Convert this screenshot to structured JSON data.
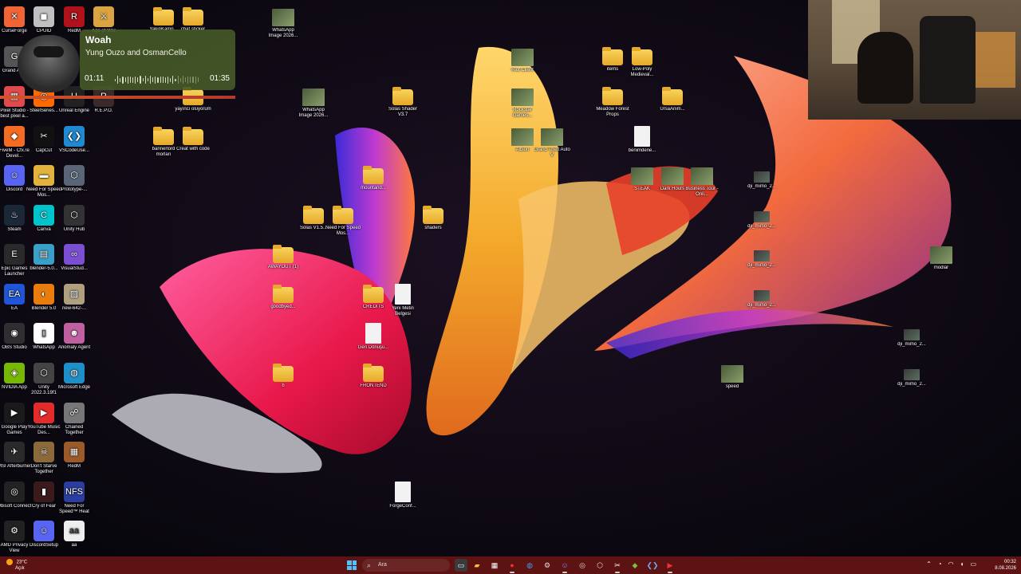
{
  "media_player": {
    "title": "Woah",
    "artist": "Yung Ouzo and OsmanCello",
    "elapsed": "01:11",
    "duration": "01:35",
    "progress": 0.72
  },
  "left_icons": [
    {
      "label": "CurseForge",
      "color": "#f16436",
      "glyph": "✕"
    },
    {
      "label": "CPUID",
      "color": "#c0c0c0",
      "glyph": "◼"
    },
    {
      "label": "RedM",
      "color": "#b0121b",
      "glyph": "R"
    },
    {
      "label": "Age of War",
      "color": "#d9a441",
      "glyph": "⚔"
    },
    {
      "label": "Grand Auto",
      "color": "#555555",
      "glyph": "G"
    },
    {
      "label": "Pixel Studio - best pixel a...",
      "color": "#e04a4a",
      "glyph": "▦"
    },
    {
      "label": "SteelSeries...",
      "color": "#ff6a00",
      "glyph": "◎"
    },
    {
      "label": "Unreal Engine",
      "color": "#222222",
      "glyph": "U"
    },
    {
      "label": "R.E.P.O.",
      "color": "#3a2a2a",
      "glyph": "R"
    },
    {
      "label": "FiveM - Cfx.re Devel...",
      "color": "#f46c22",
      "glyph": "◆"
    },
    {
      "label": "CapCut",
      "color": "#111111",
      "glyph": "✂"
    },
    {
      "label": "VSCodeUse...",
      "color": "#1f8ad2",
      "glyph": "❮❯"
    },
    {
      "label": "Discord",
      "color": "#5865f2",
      "glyph": "☺"
    },
    {
      "label": "Need For Speed Mos...",
      "color": "#e3b23c",
      "glyph": "▬"
    },
    {
      "label": "Prototype-...",
      "color": "#5a6678",
      "glyph": "⬡"
    },
    {
      "label": "Steam",
      "color": "#1b2838",
      "glyph": "♨"
    },
    {
      "label": "Canva",
      "color": "#00c4cc",
      "glyph": "C"
    },
    {
      "label": "Unity Hub",
      "color": "#333333",
      "glyph": "⬡"
    },
    {
      "label": "Epic Games Launcher",
      "color": "#2a2a2a",
      "glyph": "E"
    },
    {
      "label": "blender-5.0...",
      "color": "#3aa0c8",
      "glyph": "▤"
    },
    {
      "label": "VisualStud...",
      "color": "#7a4fd1",
      "glyph": "∞"
    },
    {
      "label": "EA",
      "color": "#1f55d8",
      "glyph": "EA"
    },
    {
      "label": "Blender 5.0",
      "color": "#e87d0d",
      "glyph": "◐"
    },
    {
      "label": "new-642-...",
      "color": "#b0a080",
      "glyph": "▨"
    },
    {
      "label": "OBS Studio",
      "color": "#302e31",
      "glyph": "◉"
    },
    {
      "label": "WhatsApp",
      "color": "#ffffff",
      "glyph": "▯"
    },
    {
      "label": "Anomaly Agent",
      "color": "#c060a0",
      "glyph": "☻"
    },
    {
      "label": "NVIDIA App",
      "color": "#76b900",
      "glyph": "◈"
    },
    {
      "label": "Unity 2022.3.19f1",
      "color": "#444444",
      "glyph": "⬡"
    },
    {
      "label": "Microsoft Edge",
      "color": "#1e90c8",
      "glyph": "◍"
    },
    {
      "label": "Google Play Games",
      "color": "#1a1a1a",
      "glyph": "▶"
    },
    {
      "label": "YouTube Music Des...",
      "color": "#e32b2b",
      "glyph": "▶"
    },
    {
      "label": "Chained Together",
      "color": "#777777",
      "glyph": "☍"
    },
    {
      "label": "MSI Afterburner",
      "color": "#2a2a2a",
      "glyph": "✈"
    },
    {
      "label": "Don't Starve Together",
      "color": "#8a6a3a",
      "glyph": "☠"
    },
    {
      "label": "RedM",
      "color": "#9a5a2a",
      "glyph": "▦"
    },
    {
      "label": "Ubisoft Connect",
      "color": "#222222",
      "glyph": "◎"
    },
    {
      "label": "Cry of Fear",
      "color": "#3a1a1a",
      "glyph": "▮"
    },
    {
      "label": "Need For Speed™ Heat",
      "color": "#2b3d9e",
      "glyph": "NFS"
    },
    {
      "label": "AMD Privacy View",
      "color": "#222222",
      "glyph": "⚙"
    },
    {
      "label": "DiscordSetup",
      "color": "#5865f2",
      "glyph": "☺"
    },
    {
      "label": "aa",
      "color": "#eeeeee",
      "glyph": "aa"
    }
  ],
  "desktop_items": [
    {
      "label": "YakinKamp...",
      "kind": "folder"
    },
    {
      "label": "chat sticker",
      "kind": "folder"
    },
    {
      "label": "WhatsApp Image 2026...",
      "kind": "img"
    },
    {
      "label": "yayıncı oluyorum",
      "kind": "folder"
    },
    {
      "label": "WhatsApp Image 2026...",
      "kind": "img"
    },
    {
      "label": "Solas Shader V3.7",
      "kind": "folder"
    },
    {
      "label": "bannerlord morları",
      "kind": "folder"
    },
    {
      "label": "Creat with code",
      "kind": "folder"
    },
    {
      "label": "mountand...",
      "kind": "folder"
    },
    {
      "label": "Solas V1.5...",
      "kind": "folder"
    },
    {
      "label": "Need For Speed Mos...",
      "kind": "folder"
    },
    {
      "label": "shaders",
      "kind": "folder"
    },
    {
      "label": "AWAYOUT (1)",
      "kind": "folder"
    },
    {
      "label": "goodbyed...",
      "kind": "folder"
    },
    {
      "label": "CREDITS",
      "kind": "folder"
    },
    {
      "label": "Yeni Metin Belgesi",
      "kind": "file"
    },
    {
      "label": "Geri Dönüşü...",
      "kind": "file"
    },
    {
      "label": "FRONTEND",
      "kind": "folder"
    },
    {
      "label": "b",
      "kind": "folder"
    },
    {
      "label": "ForgeConf...",
      "kind": "file"
    },
    {
      "label": "items",
      "kind": "folder"
    },
    {
      "label": "Low-Poly Medieval...",
      "kind": "folder"
    },
    {
      "label": "Meadow Forest Props",
      "kind": "folder"
    },
    {
      "label": "UrsaAnim...",
      "kind": "folder"
    },
    {
      "label": "benimdene...",
      "kind": "file"
    },
    {
      "label": "STEAK",
      "kind": "img"
    },
    {
      "label": "Dark Hours",
      "kind": "img"
    },
    {
      "label": "Business Tour - Onli...",
      "kind": "img"
    },
    {
      "label": "Riot Client",
      "kind": "img"
    },
    {
      "label": "Rockstar Games...",
      "kind": "img"
    },
    {
      "label": "Albion",
      "kind": "img"
    },
    {
      "label": "Grand Theft Auto V",
      "kind": "img"
    },
    {
      "label": "dji_mimo_2...",
      "kind": "img2"
    },
    {
      "label": "dji_mimo_2...",
      "kind": "img2"
    },
    {
      "label": "dji_mimo_2...",
      "kind": "img2"
    },
    {
      "label": "dji_mimo_2...",
      "kind": "img2"
    },
    {
      "label": "speed",
      "kind": "img"
    },
    {
      "label": "modlar",
      "kind": "img"
    },
    {
      "label": "dji_mimo_2...",
      "kind": "img2"
    },
    {
      "label": "dji_mimo_2...",
      "kind": "img2"
    }
  ],
  "taskbar": {
    "weather_temp": "23°C",
    "weather_desc": "Açık",
    "search_placeholder": "Ara",
    "time": "00:32",
    "date": "8.08.2026"
  }
}
